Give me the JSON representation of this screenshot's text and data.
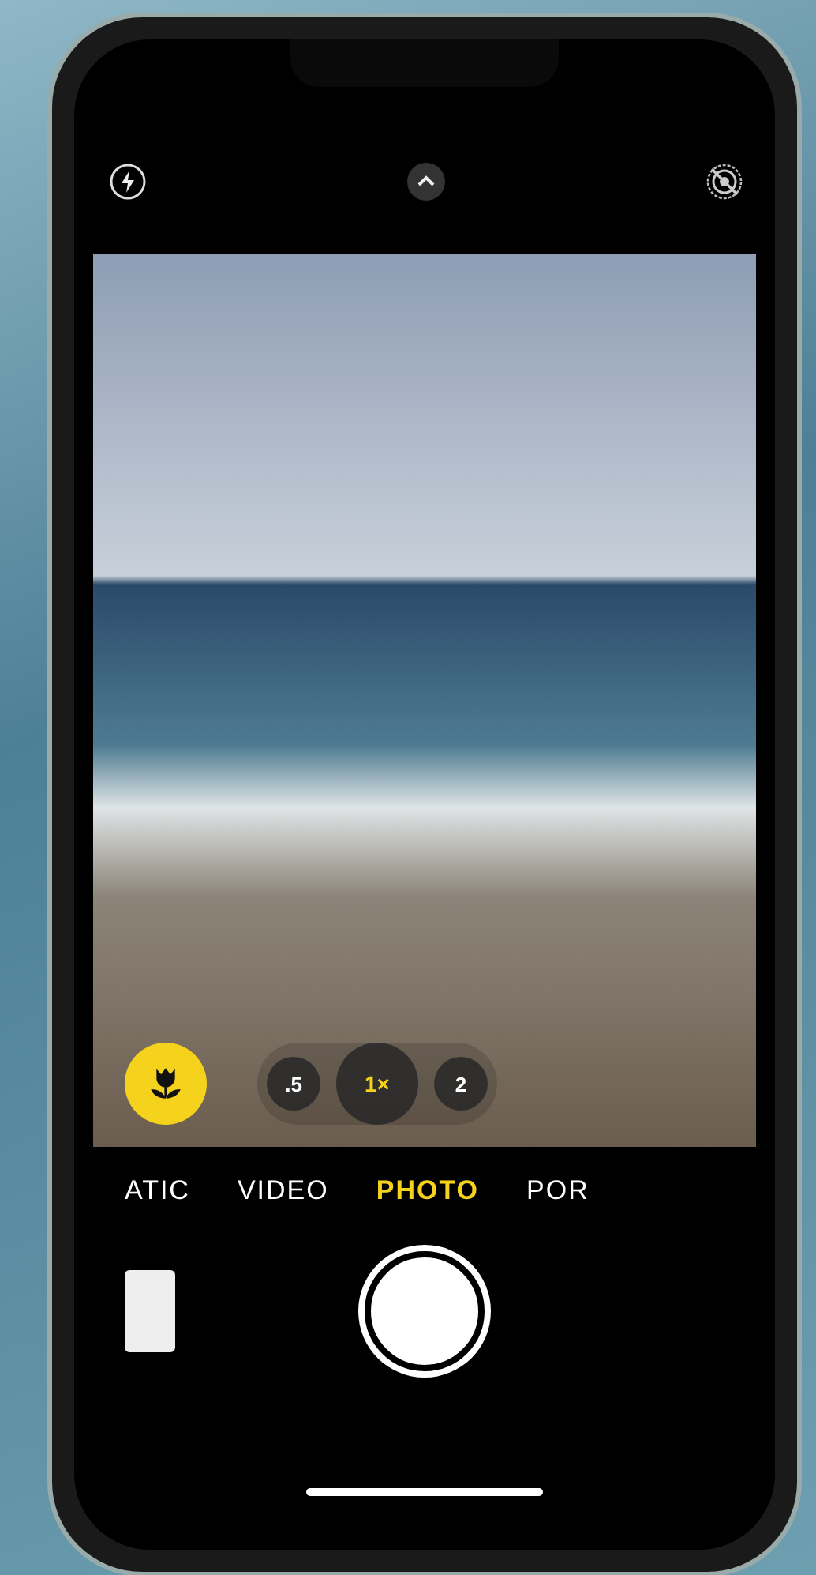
{
  "macro": {
    "on": true
  },
  "zoom_levels": [
    {
      "label": ".5",
      "selected": false
    },
    {
      "label": "1×",
      "selected": true
    },
    {
      "label": "2",
      "selected": false
    }
  ],
  "modes": [
    {
      "label": "ATIC",
      "selected": false
    },
    {
      "label": "VIDEO",
      "selected": false
    },
    {
      "label": "PHOTO",
      "selected": true
    },
    {
      "label": "POR",
      "selected": false
    }
  ]
}
